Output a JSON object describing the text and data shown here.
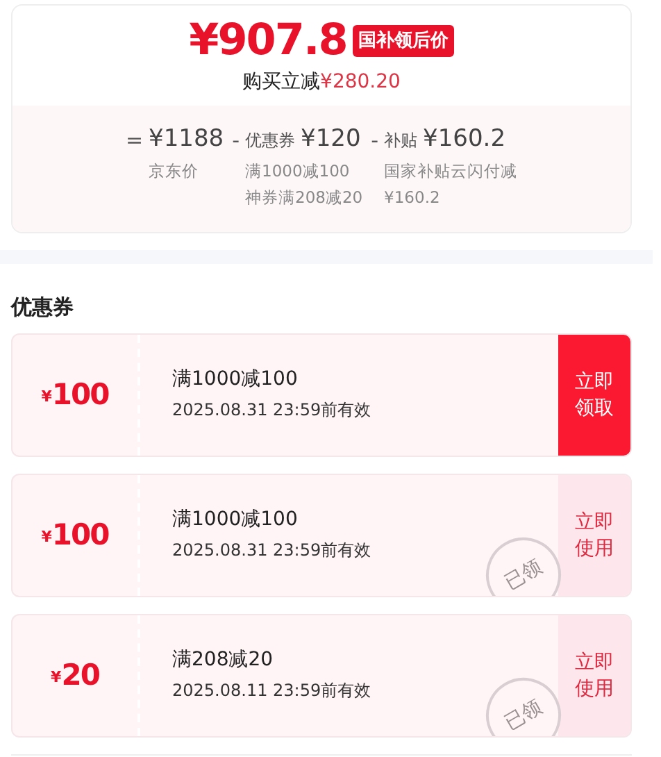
{
  "price_card": {
    "final_price": "¥907.8",
    "price_tag": "国补领后价",
    "saving_label": "购买立减",
    "saving_amount": "¥280.20",
    "breakdown": [
      {
        "operator": "=",
        "amount": "¥1188",
        "notes": [
          "京东价"
        ]
      },
      {
        "operator": "-",
        "name": "优惠券",
        "amount": "¥120",
        "notes": [
          "满1000减100",
          "神券满208减20"
        ]
      },
      {
        "operator": "-",
        "name": "补贴",
        "amount": "¥160.2",
        "notes": [
          "国家补贴云闪付减",
          "¥160.2"
        ]
      }
    ]
  },
  "coupons_section": {
    "title": "优惠券",
    "coupons": [
      {
        "currency": "¥",
        "amount": "100",
        "condition": "满1000减100",
        "validity": "2025.08.31 23:59前有效",
        "action": [
          "立即",
          "领取"
        ],
        "claimed": false
      },
      {
        "currency": "¥",
        "amount": "100",
        "condition": "满1000减100",
        "validity": "2025.08.31 23:59前有效",
        "action": [
          "立即",
          "使用"
        ],
        "claimed": true,
        "stamp": "已领"
      },
      {
        "currency": "¥",
        "amount": "20",
        "condition": "满208减20",
        "validity": "2025.08.11 23:59前有效",
        "action": [
          "立即",
          "使用"
        ],
        "claimed": true,
        "stamp": "已领"
      }
    ]
  }
}
